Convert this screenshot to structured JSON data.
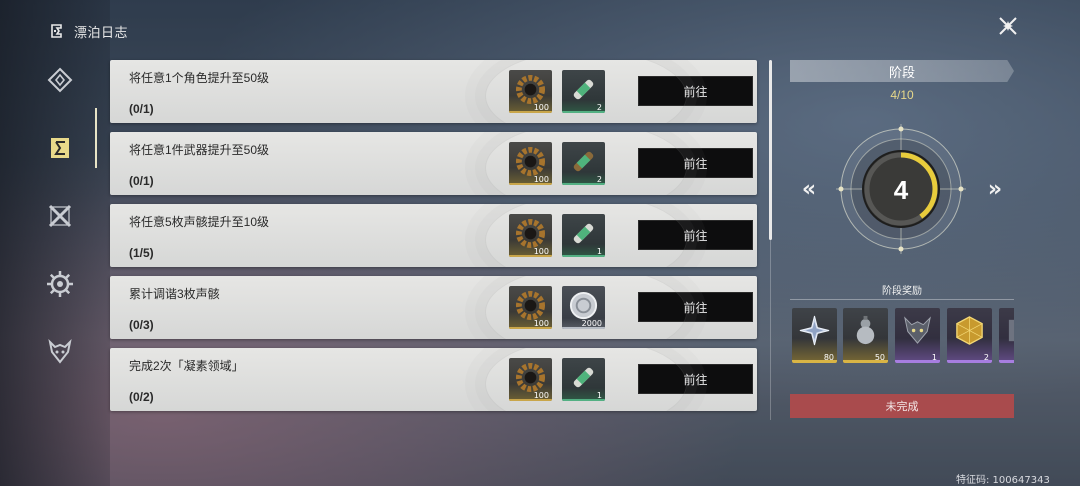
{
  "header": {
    "title": "漂泊日志",
    "icon": "journal-icon",
    "close_icon": "close-x-icon"
  },
  "nav": {
    "items": [
      {
        "icon": "diamond-emblem-icon",
        "active": false
      },
      {
        "icon": "journal-icon",
        "active": true
      },
      {
        "icon": "crossed-blades-icon",
        "active": false
      },
      {
        "icon": "gear-sun-icon",
        "active": false
      },
      {
        "icon": "beast-mask-icon",
        "active": false
      }
    ]
  },
  "tasks": [
    {
      "title": "将任意1个角色提升至50级",
      "progress": "(0/1)",
      "go_label": "前往",
      "rewards": [
        {
          "icon": "ring-gear-icon",
          "count": "100",
          "rarity": "gold"
        },
        {
          "icon": "green-capsule-icon",
          "count": "2",
          "rarity": "green"
        }
      ]
    },
    {
      "title": "将任意1件武器提升至50级",
      "progress": "(0/1)",
      "go_label": "前往",
      "rewards": [
        {
          "icon": "ring-gear-icon",
          "count": "100",
          "rarity": "gold"
        },
        {
          "icon": "green-capsule-icon",
          "count": "2",
          "rarity": "green"
        }
      ]
    },
    {
      "title": "将任意5枚声骸提升至10级",
      "progress": "(1/5)",
      "go_label": "前往",
      "rewards": [
        {
          "icon": "ring-gear-icon",
          "count": "100",
          "rarity": "gold"
        },
        {
          "icon": "green-capsule-icon",
          "count": "1",
          "rarity": "green"
        }
      ]
    },
    {
      "title": "累计调谐3枚声骸",
      "progress": "(0/3)",
      "go_label": "前往",
      "rewards": [
        {
          "icon": "ring-gear-icon",
          "count": "100",
          "rarity": "gold"
        },
        {
          "icon": "silver-shell-coin-icon",
          "count": "2000",
          "rarity": "silver"
        }
      ]
    },
    {
      "title": "完成2次「凝素领域」",
      "progress": "(0/2)",
      "go_label": "前往",
      "rewards": [
        {
          "icon": "ring-gear-icon",
          "count": "100",
          "rarity": "gold"
        },
        {
          "icon": "green-capsule-icon",
          "count": "1",
          "rarity": "green"
        }
      ]
    }
  ],
  "stage": {
    "title": "阶段",
    "fraction": "4/10",
    "current": "4",
    "progress_fraction": 0.4,
    "prev_label": "«",
    "next_label": "»",
    "rewards_label": "阶段奖励",
    "rewards": [
      {
        "icon": "crystal-star-icon",
        "count": "80",
        "rarity": "gold"
      },
      {
        "icon": "gourd-bottle-icon",
        "count": "50",
        "rarity": "gold"
      },
      {
        "icon": "wolf-head-icon",
        "count": "1",
        "rarity": "purple"
      },
      {
        "icon": "gold-cube-icon",
        "count": "2",
        "rarity": "purple"
      },
      {
        "icon": "partial-item-icon",
        "count": "",
        "rarity": "purple"
      }
    ],
    "status_button": "未完成"
  },
  "footer": {
    "uid": "特征码: 100647343"
  },
  "colors": {
    "accent_gold": "#e8d98a",
    "go_button": "#0d0d0e",
    "incomplete": "#a94b4d",
    "dial_arc": "#e8cc3c"
  }
}
